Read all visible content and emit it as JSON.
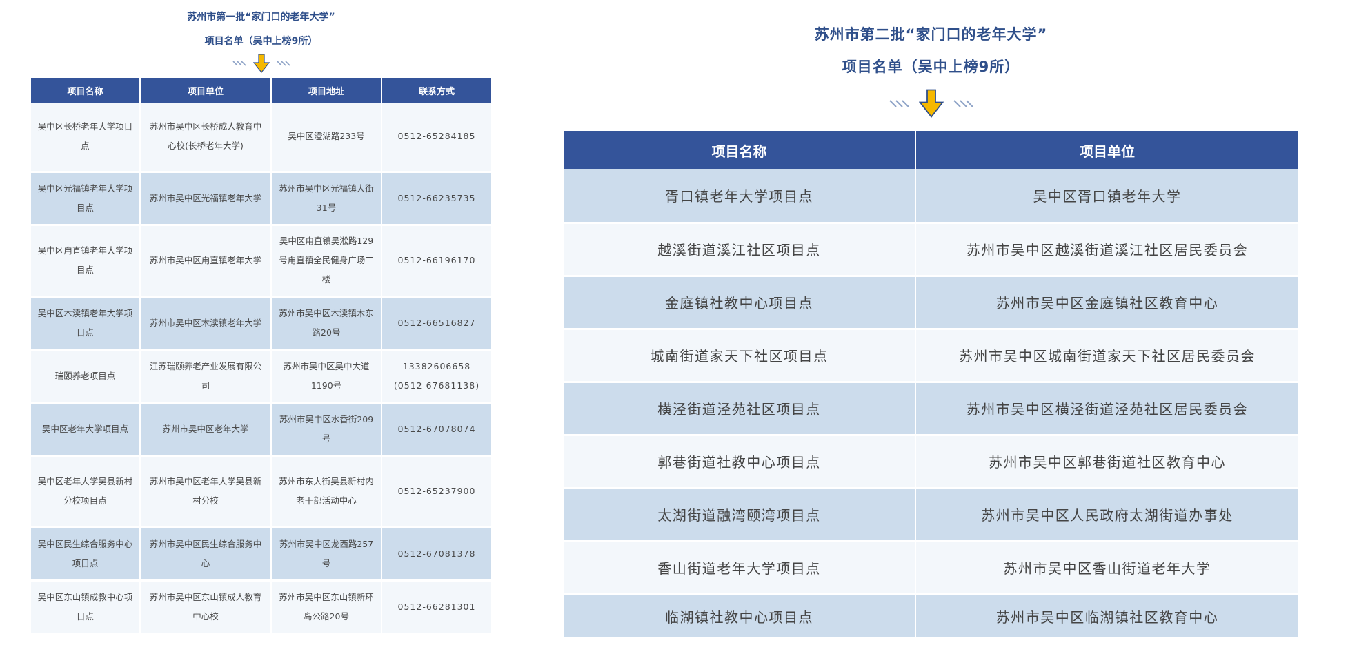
{
  "left": {
    "title_line1": "苏州市第一批“家门口的老年大学”",
    "title_line2": "项目名单（吴中上榜9所）",
    "headers": [
      "项目名称",
      "项目单位",
      "项目地址",
      "联系方式"
    ],
    "rows": [
      [
        "吴中区长桥老年大学项目点",
        "苏州市吴中区长桥成人教育中心校(长桥老年大学)",
        "吴中区澄湖路233号",
        "0512-65284185"
      ],
      [
        "吴中区光福镇老年大学项目点",
        "苏州市吴中区光福镇老年大学",
        "苏州市吴中区光福镇大街31号",
        "0512-66235735"
      ],
      [
        "吴中区甪直镇老年大学项目点",
        "苏州市吴中区甪直镇老年大学",
        "吴中区甪直镇吴淞路129号甪直镇全民健身广场二楼",
        "0512-66196170"
      ],
      [
        "吴中区木渎镇老年大学项目点",
        "苏州市吴中区木渎镇老年大学",
        "苏州市吴中区木渎镇木东路20号",
        "0512-66516827"
      ],
      [
        "瑞颐养老项目点",
        "江苏瑞颐养老产业发展有限公司",
        "苏州市吴中区吴中大道1190号",
        "13382606658 (0512 67681138)"
      ],
      [
        "吴中区老年大学项目点",
        "苏州市吴中区老年大学",
        "苏州市吴中区水香街209号",
        "0512-67078074"
      ],
      [
        "吴中区老年大学吴县新村分校项目点",
        "苏州市吴中区老年大学吴县新村分校",
        "苏州市东大街吴县新村内老干部活动中心",
        "0512-65237900"
      ],
      [
        "吴中区民生综合服务中心项目点",
        "苏州市吴中区民生综合服务中心",
        "苏州市吴中区龙西路257号",
        "0512-67081378"
      ],
      [
        "吴中区东山镇成教中心项目点",
        "苏州市吴中区东山镇成人教育中心校",
        "苏州市吴中区东山镇新环岛公路20号",
        "0512-66281301"
      ]
    ]
  },
  "right": {
    "title_line1": "苏州市第二批“家门口的老年大学”",
    "title_line2": "项目名单（吴中上榜9所）",
    "headers": [
      "项目名称",
      "项目单位"
    ],
    "rows": [
      [
        "胥口镇老年大学项目点",
        "吴中区胥口镇老年大学"
      ],
      [
        "越溪街道溪江社区项目点",
        "苏州市吴中区越溪街道溪江社区居民委员会"
      ],
      [
        "金庭镇社教中心项目点",
        "苏州市吴中区金庭镇社区教育中心"
      ],
      [
        "城南街道家天下社区项目点",
        "苏州市吴中区城南街道家天下社区居民委员会"
      ],
      [
        "横泾街道泾苑社区项目点",
        "苏州市吴中区横泾街道泾苑社区居民委员会"
      ],
      [
        "郭巷街道社教中心项目点",
        "苏州市吴中区郭巷街道社区教育中心"
      ],
      [
        "太湖街道融湾颐湾项目点",
        "苏州市吴中区人民政府太湖街道办事处"
      ],
      [
        "香山街道老年大学项目点",
        "苏州市吴中区香山街道老年大学"
      ],
      [
        "临湖镇社教中心项目点",
        "苏州市吴中区临湖镇社区教育中心"
      ]
    ]
  },
  "colors": {
    "header_bg": "#34549a",
    "title_text": "#2f4f8a",
    "row_light": "#f3f7fb",
    "row_dark": "#ccdcec",
    "arrow": "#f5b800"
  },
  "icons": [
    "down-arrow-icon",
    "slash-lines-decoration"
  ]
}
